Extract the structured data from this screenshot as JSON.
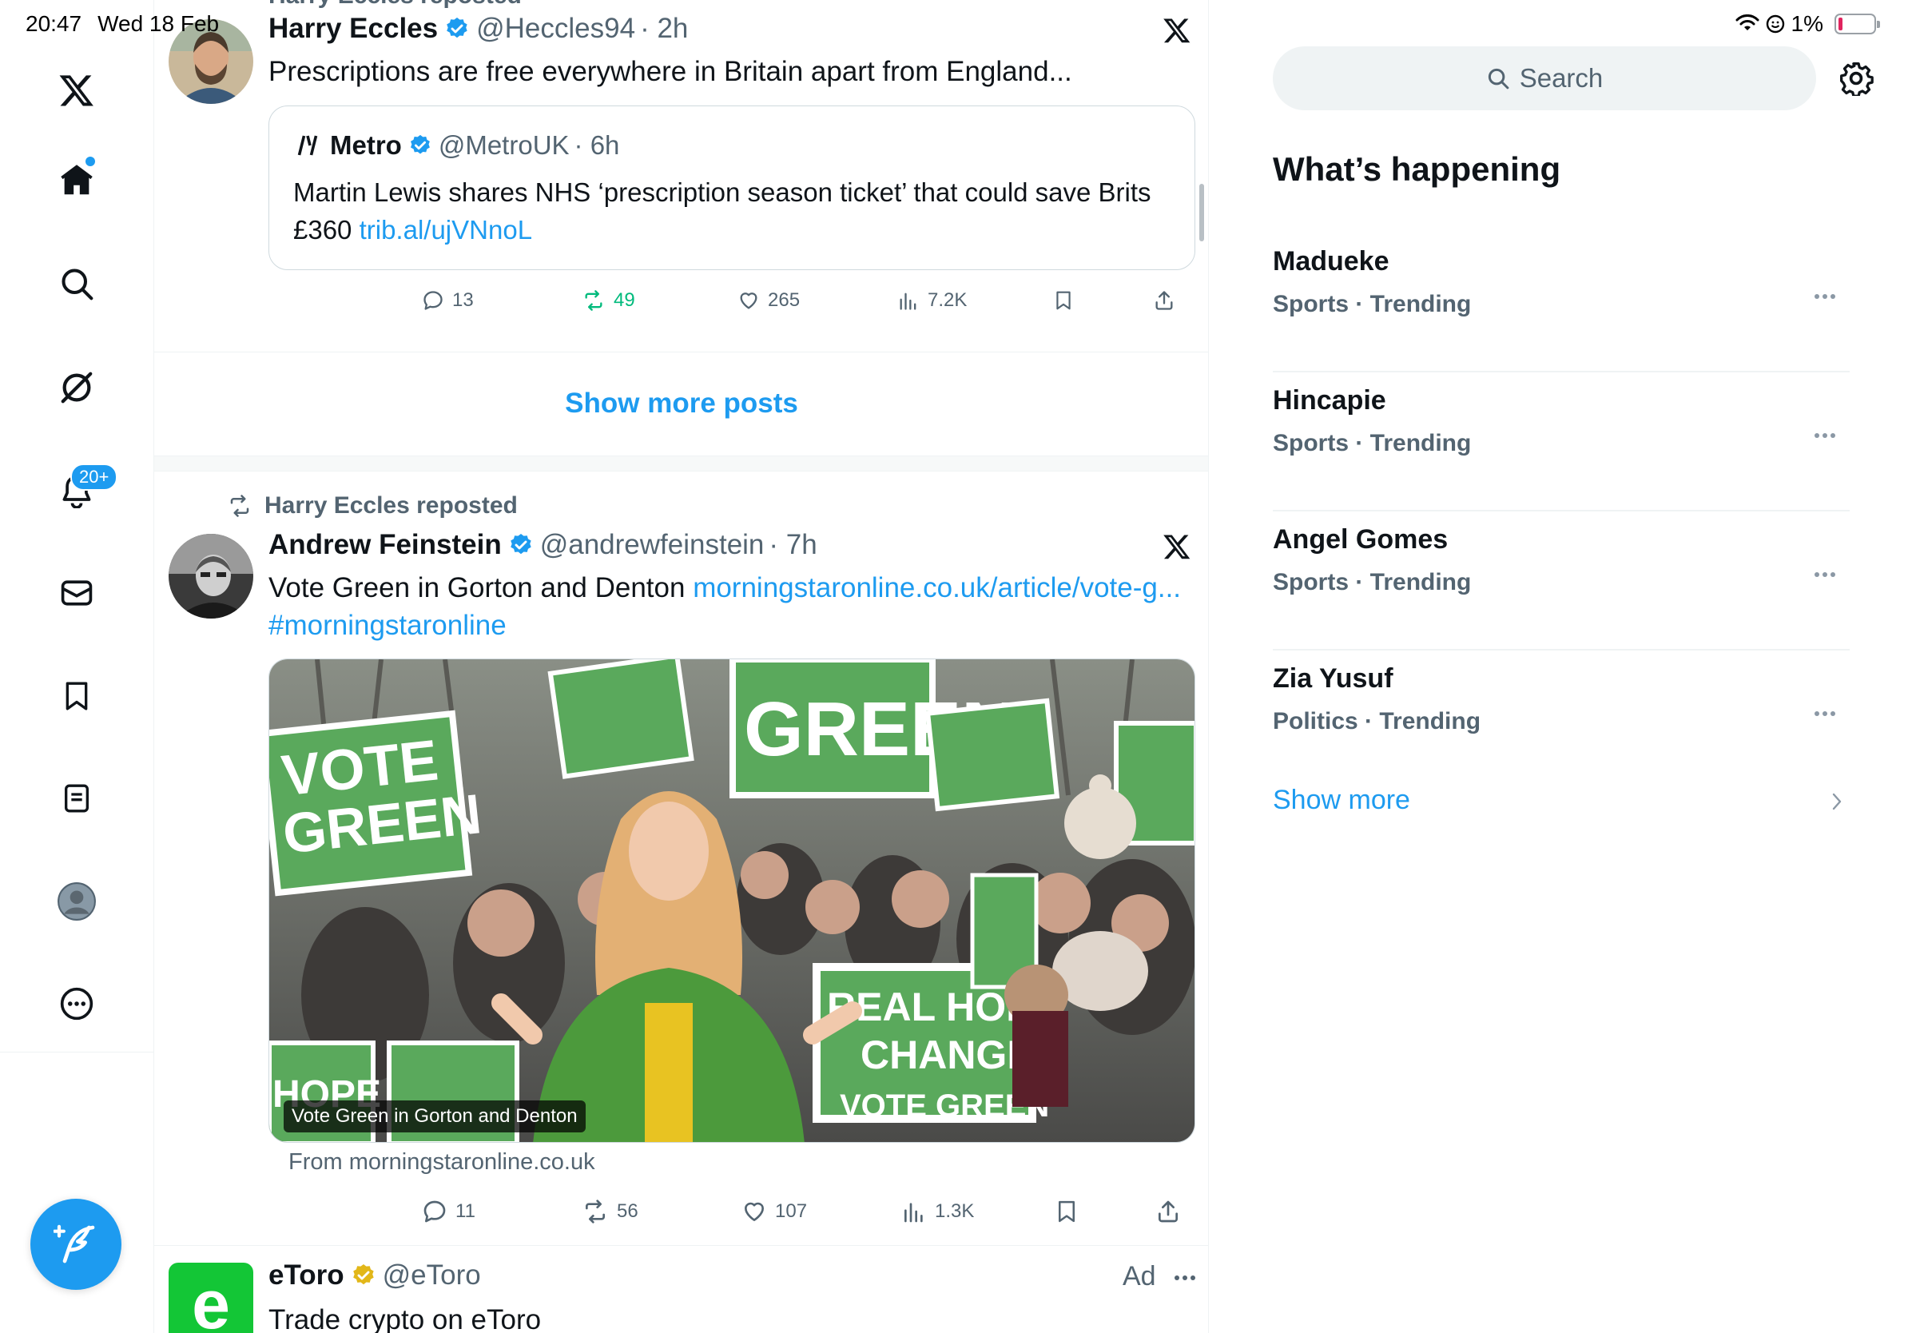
{
  "status_bar": {
    "time": "20:47",
    "date": "Wed 18 Feb",
    "battery": "1%"
  },
  "nav": {
    "items": [
      "x-logo",
      "home",
      "search",
      "grok",
      "notifications",
      "messages",
      "bookmarks",
      "lists",
      "profile",
      "more"
    ],
    "notifications_badge": "20+"
  },
  "feed": {
    "top_partial": "Harry Eccles reposted",
    "tweet1": {
      "name": "Harry Eccles",
      "handle": "@Heccles94",
      "time": "· 2h",
      "text": "Prescriptions are free everywhere in Britain apart from England...",
      "quote": {
        "name": "Metro",
        "handle": "@MetroUK",
        "time": "· 6h",
        "text": "Martin Lewis shares NHS ‘prescription season ticket’ that could save Brits £360 ",
        "link": "trib.al/ujVNnoL"
      },
      "stats": {
        "replies": "13",
        "reposts": "49",
        "likes": "265",
        "views": "7.2K"
      }
    },
    "show_more_posts": "Show more posts",
    "tweet2": {
      "reposted_by": "Harry Eccles reposted",
      "name": "Andrew Feinstein",
      "handle": "@andrewfeinstein",
      "time": "· 7h",
      "text": "Vote Green in Gorton and Denton ",
      "link": "morningstaronline.co.uk/article/vote-g...",
      "hashtag": "#morningstaronline",
      "media_caption": "Vote Green in Gorton and Denton",
      "from": "From morningstaronline.co.uk",
      "stats": {
        "replies": "11",
        "reposts": "56",
        "likes": "107",
        "views": "1.3K"
      },
      "signs": {
        "vote": "VOTE",
        "green": "GREEN",
        "real_hope": "REAL HOPE",
        "change": "CHANGE",
        "hope": "HOPE",
        "vote_green": "VOTE GREEN"
      }
    },
    "ad": {
      "name": "eToro",
      "handle": "@eToro",
      "label": "Ad",
      "text": "Trade crypto on eToro",
      "logo_letter": "e"
    }
  },
  "sidebar": {
    "search_placeholder": "Search",
    "title": "What’s happening",
    "trends": [
      {
        "name": "Madueke",
        "meta": "Sports · Trending"
      },
      {
        "name": "Hincapie",
        "meta": "Sports · Trending"
      },
      {
        "name": "Angel Gomes",
        "meta": "Sports · Trending"
      },
      {
        "name": "Zia Yusuf",
        "meta": "Politics · Trending"
      }
    ],
    "show_more": "Show more"
  },
  "colors": {
    "accent": "#1d9bf0",
    "text": "#0f1419",
    "muted": "#536471",
    "repost_green": "#00ba7c",
    "gold": "#e2b719"
  }
}
